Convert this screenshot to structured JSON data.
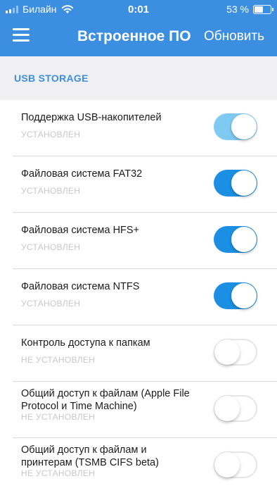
{
  "status_bar": {
    "carrier": "Билайн",
    "time": "0:01",
    "battery_percent": "53 %",
    "battery_level": 0.53
  },
  "nav": {
    "title": "Встроенное ПО",
    "action_label": "Обновить"
  },
  "section": {
    "title": "USB STORAGE"
  },
  "items": [
    {
      "label": "Поддержка USB-накопителей",
      "status": "УСТАНОВЛЕН",
      "enabled": true,
      "variant": "light"
    },
    {
      "label": "Файловая система FAT32",
      "status": "УСТАНОВЛЕН",
      "enabled": true
    },
    {
      "label": "Файловая система HFS+",
      "status": "УСТАНОВЛЕН",
      "enabled": true
    },
    {
      "label": "Файловая система NTFS",
      "status": "УСТАНОВЛЕН",
      "enabled": true
    },
    {
      "label": "Контроль доступа к папкам",
      "status": "НЕ УСТАНОВЛЕН",
      "enabled": false
    },
    {
      "label": "Общий доступ к файлам (Apple File Protocol и Time Machine)",
      "status": "НЕ УСТАНОВЛЕН",
      "enabled": false
    },
    {
      "label": "Общий доступ к файлам и принтерам (TSMB CIFS beta)",
      "status": "НЕ УСТАНОВЛЕН",
      "enabled": false
    }
  ],
  "colors": {
    "accent": "#3c8ee0",
    "toggle_on": "#1a8fe3",
    "toggle_on_light": "#7fcaf3"
  }
}
